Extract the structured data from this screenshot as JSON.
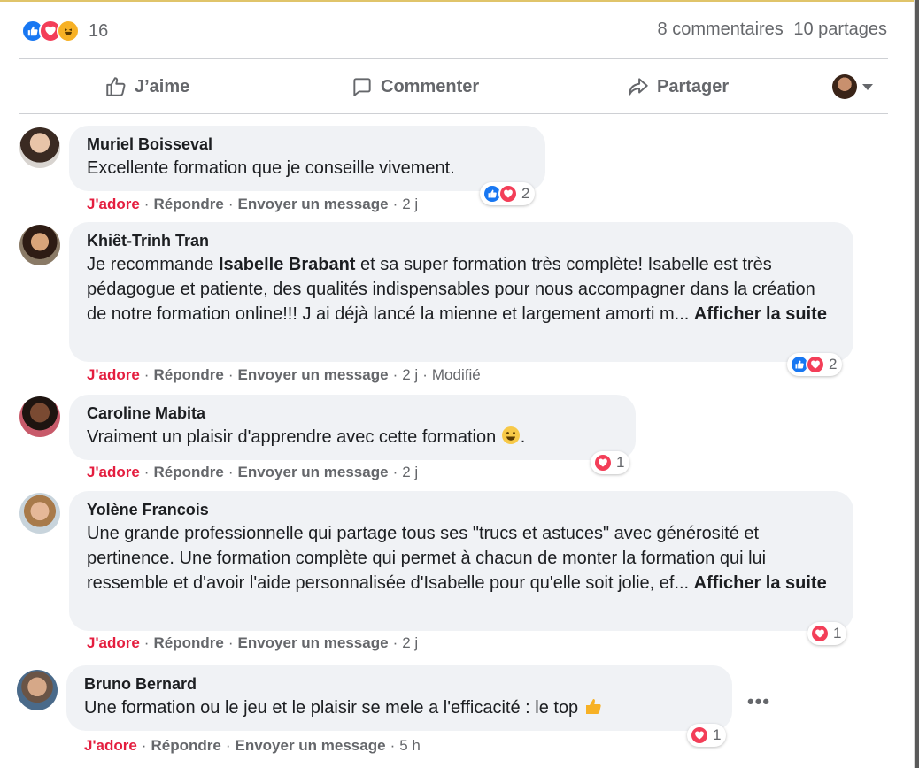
{
  "summary": {
    "reaction_count": "16",
    "comments": "8 commentaires",
    "shares": "10 partages",
    "reaction_icons": [
      "like-icon",
      "love-icon",
      "haha-icon"
    ]
  },
  "actions": {
    "like": "J’aime",
    "comment": "Commenter",
    "share": "Partager"
  },
  "comment_actions": {
    "adore": "J'adore",
    "reply": "Répondre",
    "message": "Envoyer un message",
    "modified": "Modifié",
    "see_more": "Afficher la suite"
  },
  "colors": {
    "accent_blue": "#1877f2",
    "love_red": "#f33e58",
    "adore_red": "#e41e3f",
    "bubble_bg": "#f0f2f5",
    "muted_text": "#65676b"
  },
  "comments": [
    {
      "author": "Muriel Boisseval",
      "text": "Excellente formation que je conseille vivement.",
      "time": "2 j",
      "reactions": "2"
    },
    {
      "author": "Khiêt-Trinh Tran",
      "text_before": "Je recommande ",
      "mention": "Isabelle Brabant",
      "text_after": " et sa super formation très complète! Isabelle est très pédagogue et patiente, des qualités indispensables pour nous accompagner dans la création de notre formation online!!! J ai déjà lancé la mienne et largement amorti m... ",
      "time": "2 j",
      "reactions": "2"
    },
    {
      "author": "Caroline Mabita",
      "text": "Vraiment un plaisir d'apprendre avec cette formation ",
      "text_end": ".",
      "time": "2 j",
      "reactions": "1"
    },
    {
      "author": "Yolène Francois",
      "text": "Une grande professionnelle qui partage tous ses \"trucs et astuces\" avec générosité et pertinence. Une formation complète qui permet à chacun de monter la formation qui lui ressemble et d'avoir l'aide personnalisée d'Isabelle pour qu'elle soit jolie, ef... ",
      "time": "2 j",
      "reactions": "1"
    },
    {
      "author": "Bruno Bernard",
      "text": "Une formation ou le jeu et le plaisir se mele a l'efficacité : le top ",
      "time": "5 h",
      "reactions": "1"
    }
  ]
}
